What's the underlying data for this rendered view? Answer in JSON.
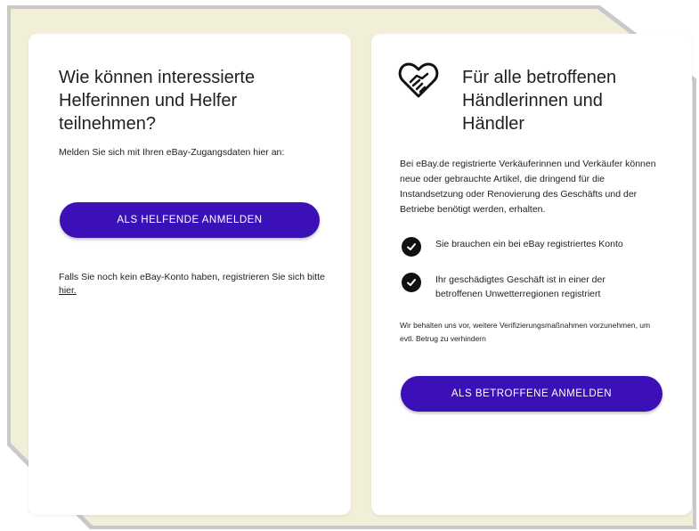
{
  "helper_card": {
    "title": "Wie können interessierte Helferinnen und Helfer teilnehmen?",
    "intro": "Melden Sie sich mit Ihren eBay-Zugangsdaten hier an:",
    "button_label": "ALS HELFENDE ANMELDEN",
    "register_text": "Falls Sie noch kein eBay-Konto haben, registrieren Sie sich bitte",
    "register_link": "hier."
  },
  "merchant_card": {
    "icon": "heart-handshake-icon",
    "title": "Für alle betroffenen Händlerinnen und Händler",
    "description": "Bei eBay.de registrierte Verkäuferinnen und Verkäufer können neue oder gebrauchte Artikel, die dringend für die Instandsetzung oder Renovierung des Geschäfts und der Betriebe benötigt werden, erhalten.",
    "requirements": [
      "Sie brauchen ein bei eBay registriertes Konto",
      "Ihr geschädigtes Geschäft ist in einer der betroffenen Unwetterregionen registriert"
    ],
    "disclaimer": "Wir behalten uns vor, weitere Verifizierungsmaßnahmen vorzunehmen, um evtl. Betrug zu verhindern",
    "button_label": "ALS BETROFFENE ANMELDEN"
  },
  "colors": {
    "button": "#3b10b6",
    "page_background": "#f2efd8",
    "card": "#ffffff"
  }
}
